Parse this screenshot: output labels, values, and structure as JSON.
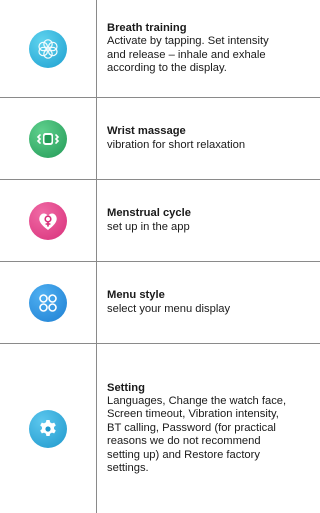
{
  "rows": [
    {
      "title": "Breath training",
      "desc": "Activate by tapping.  Set intensity\nand release – inhale and exhale\naccording to the display.",
      "icon": "breath-icon",
      "color": "#2bb3d9"
    },
    {
      "title": "Wrist massage",
      "desc": "vibration for short relaxation",
      "icon": "massage-icon",
      "color": "#34b16a"
    },
    {
      "title": "Menstrual cycle",
      "desc": "set up in the app",
      "icon": "menstrual-icon",
      "color": "#e8438a"
    },
    {
      "title": "Menu style",
      "desc": "select your menu display",
      "icon": "menu-style-icon",
      "color": "#2f8fe0"
    },
    {
      "title": "Setting",
      "desc": "Languages, Change the watch face,\nScreen timeout, Vibration intensity,\nBT calling, Password (for practical\nreasons we do not recommend\nsetting up) and Restore factory\nsettings.",
      "icon": "settings-gear-icon",
      "color": "#2aa9dc"
    }
  ]
}
